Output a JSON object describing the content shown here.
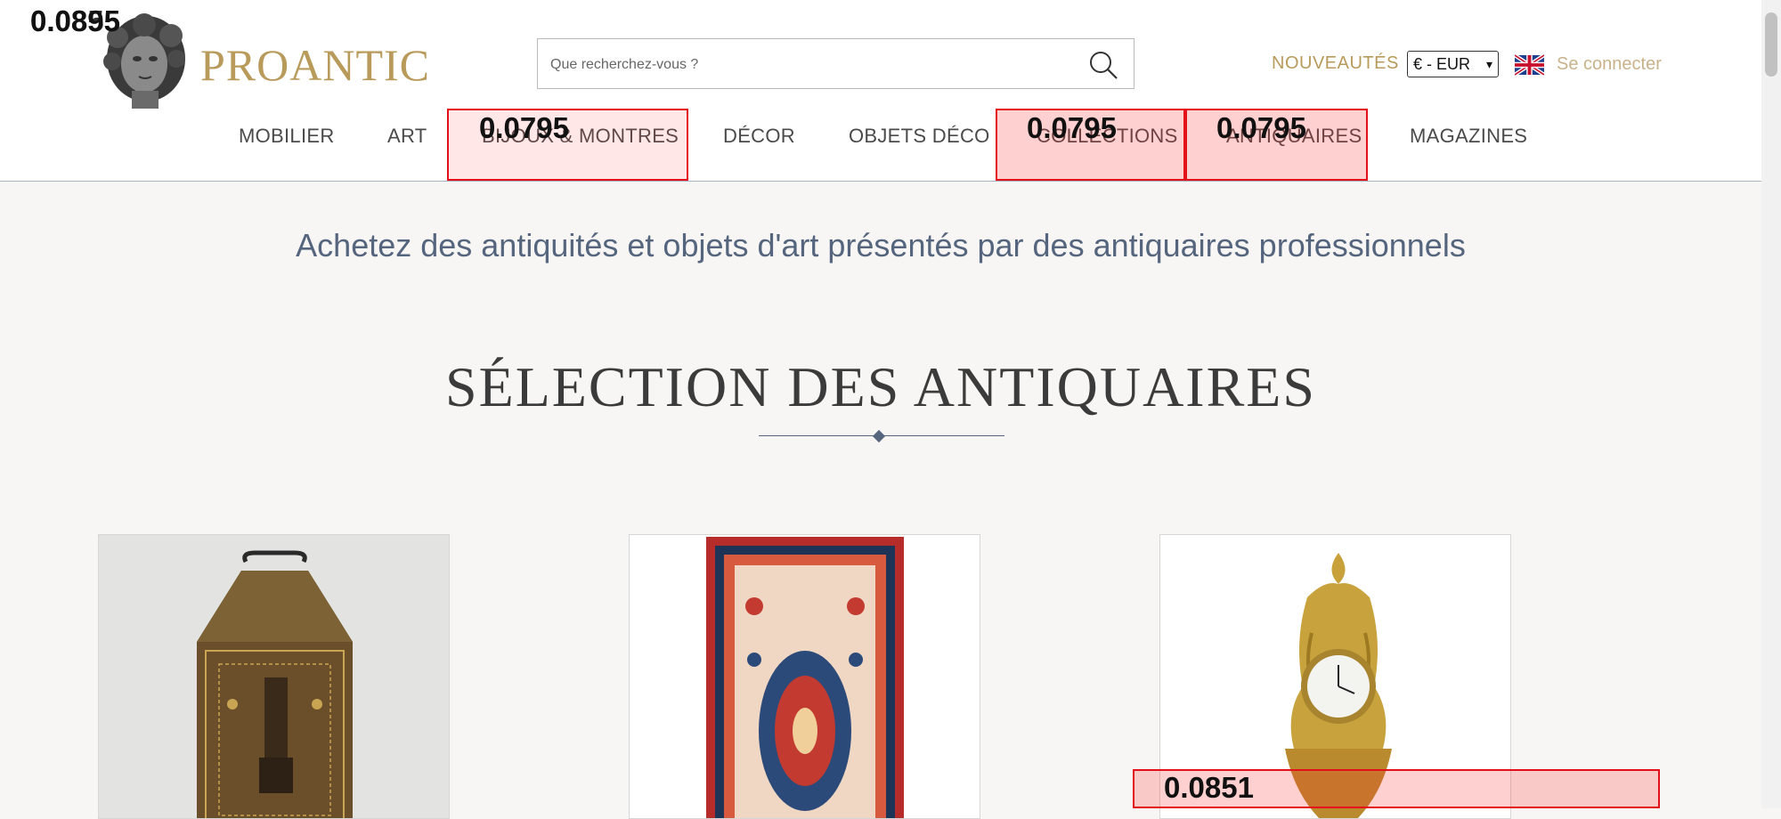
{
  "header": {
    "logo_text": "PROANTIC",
    "search_placeholder": "Que recherchez-vous ?",
    "nouveautes": "NOUVEAUTÉS",
    "currency": "€ - EUR",
    "login": "Se connecter"
  },
  "nav": [
    "MOBILIER",
    "ART",
    "BIJOUX & MONTRES",
    "DÉCOR",
    "OBJETS DÉCO",
    "COLLECTIONS",
    "ANTIQUAIRES",
    "MAGAZINES"
  ],
  "tagline": "Achetez des antiquités et objets d'art présentés par des antiquaires professionnels",
  "section_title": "SÉLECTION DES ANTIQUAIRES",
  "overlay_scores": {
    "logo_a": "0.0895",
    "logo_b": "0.0855",
    "bijoux": "0.0795",
    "collections": "0.0795",
    "antiquaires": "0.0795",
    "card3": "0.0851"
  },
  "colors": {
    "gold": "#b89a5b",
    "navy": "#55657e",
    "highlight": "#e3101a"
  },
  "icons": [
    "search-icon",
    "uk-flag-icon",
    "chevron-down-icon",
    "logo-bust-icon"
  ]
}
